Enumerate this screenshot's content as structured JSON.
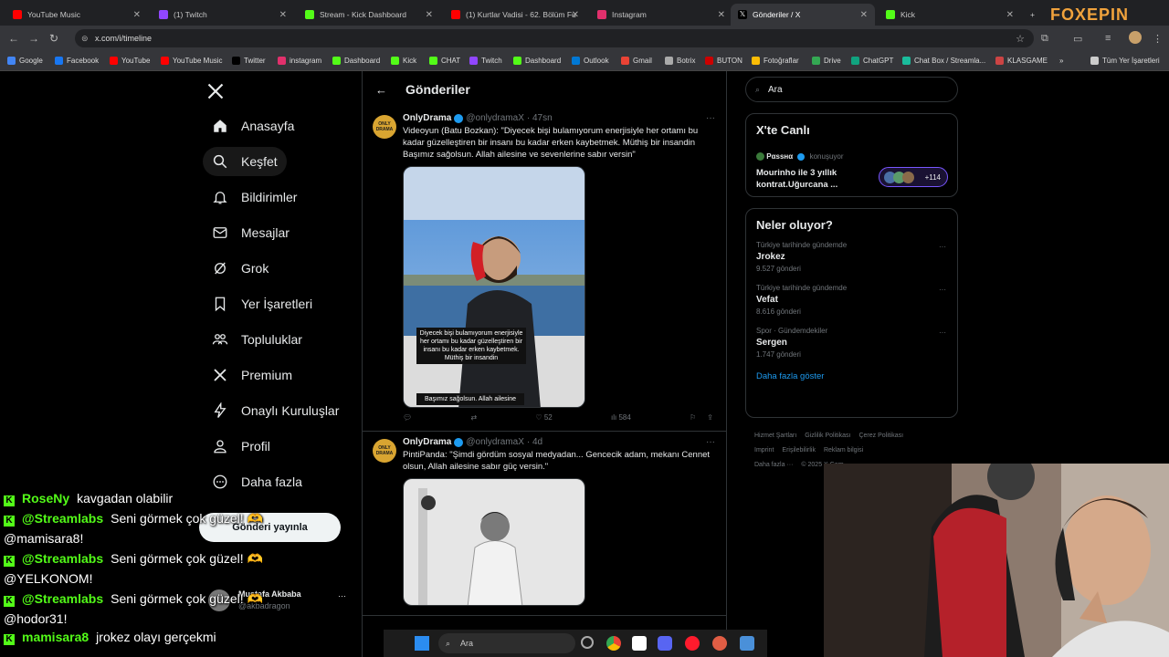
{
  "browser": {
    "tabs": [
      {
        "title": "YouTube Music",
        "color": "#ff0000"
      },
      {
        "title": "(1) Twitch",
        "color": "#9146ff"
      },
      {
        "title": "Stream - Kick Dashboard",
        "color": "#53fc18"
      },
      {
        "title": "(1) Kurtlar Vadisi - 62. Bölüm Fu",
        "color": "#ff0000"
      },
      {
        "title": "Instagram",
        "color": "#e1306c"
      },
      {
        "title": "Gönderiler / X",
        "color": "#000000"
      },
      {
        "title": "Kick",
        "color": "#53fc18"
      }
    ],
    "new_tab": "+",
    "url": "x.com/i/timeline",
    "bookmarks": [
      "Google",
      "Facebook",
      "YouTube",
      "YouTube Music",
      "Twitter",
      "instagram",
      "Dashboard",
      "Kick",
      "CHAT",
      "Twitch",
      "Dashboard",
      "Outlook",
      "Gmail",
      "Botrix",
      "BUTON",
      "Fotoğraflar",
      "Drive",
      "ChatGPT",
      "Chat Box / Streamla...",
      "KLASGAME"
    ],
    "all_bookmarks": "Tüm Yer İşaretleri",
    "overlay_logo": "FOXEPIN"
  },
  "sidebar": {
    "items": [
      {
        "label": "Anasayfa",
        "icon": "home-icon"
      },
      {
        "label": "Keşfet",
        "icon": "search-icon"
      },
      {
        "label": "Bildirimler",
        "icon": "bell-icon"
      },
      {
        "label": "Mesajlar",
        "icon": "mail-icon"
      },
      {
        "label": "Grok",
        "icon": "grok-icon"
      },
      {
        "label": "Yer İşaretleri",
        "icon": "bookmark-icon"
      },
      {
        "label": "Topluluklar",
        "icon": "community-icon"
      },
      {
        "label": "Premium",
        "icon": "x-icon"
      },
      {
        "label": "Onaylı Kuruluşlar",
        "icon": "bolt-icon"
      },
      {
        "label": "Profil",
        "icon": "person-icon"
      },
      {
        "label": "Daha fazla",
        "icon": "more-circle-icon"
      }
    ],
    "post_button": "Gönderi yayınla",
    "profile_name": "Mustafa Akbaba",
    "profile_handle": "@akbadragon"
  },
  "main": {
    "title": "Gönderiler",
    "tweets": [
      {
        "name": "OnlyDrama",
        "handle": "@onlydramaX",
        "time": "· 47sn",
        "text": "Videoyun (Batu Bozkan): \"Diyecek bişi bulamıyorum enerjisiyle her ortamı bu kadar güzelleştiren bir insanı bu kadar erken kaybetmek. Müthiş bir insandin\nBaşımız sağolsun. Allah ailesine ve sevenlerine sabır versin\"",
        "caption": "Diyecek bişi bulamıyorum enerjisiyle her ortamı bu kadar güzelleştiren bir insanı bu kadar erken kaybetmek. Müthiş bir insandin",
        "caption2": "Başımız sağolsun. Allah ailesine",
        "likes": "52",
        "views": "584"
      },
      {
        "name": "OnlyDrama",
        "handle": "@onlydramaX",
        "time": "· 4d",
        "text": "PintiPanda: \"Şimdi gördüm sosyal medyadan... Gencecik adam, mekanı Cennet olsun, Allah ailesine sabır güç versin.\""
      }
    ],
    "avatar_text": "ONLY DRAMA"
  },
  "right": {
    "search_placeholder": "Ara",
    "live": {
      "title": "X'te Canlı",
      "host": "Pαssнα",
      "status": "konuşuyor",
      "text": "Mourinho ile 3 yıllık kontrat.Uğurcana ...",
      "count": "+114"
    },
    "trends_title": "Neler oluyor?",
    "trends": [
      {
        "context": "Türkiye tarihinde gündemde",
        "name": "Jrokez",
        "posts": "9.527 gönderi"
      },
      {
        "context": "Türkiye tarihinde gündemde",
        "name": "Vefat",
        "posts": "8.616 gönderi"
      },
      {
        "context": "Spor · Gündemdekiler",
        "name": "Sergen",
        "posts": "1.747 gönderi"
      }
    ],
    "show_more": "Daha fazla göster",
    "footer": [
      "Hizmet Şartları",
      "Gizlilik Politikası",
      "Çerez Politikası",
      "Imprint",
      "Erişilebilirlik",
      "Reklam bilgisi",
      "Daha fazla ···",
      "© 2025 X Corp."
    ]
  },
  "chat": {
    "lines": [
      {
        "user": "RoseNy",
        "msg": "kavgadan olabilir"
      },
      {
        "user": "@Streamlabs",
        "msg": "Seni görmek çok güzel! 🫶"
      },
      {
        "user": "",
        "msg": "@mamisara8!"
      },
      {
        "user": "@Streamlabs",
        "msg": "Seni görmek çok güzel! 🫶"
      },
      {
        "user": "",
        "msg": "@YELKONOM!"
      },
      {
        "user": "@Streamlabs",
        "msg": "Seni görmek çok güzel! 🫶"
      },
      {
        "user": "",
        "msg": "@hodor31!"
      },
      {
        "user": "mamisara8",
        "msg": "jrokez olayı gerçekmi"
      }
    ]
  },
  "taskbar": {
    "search": "Ara"
  }
}
